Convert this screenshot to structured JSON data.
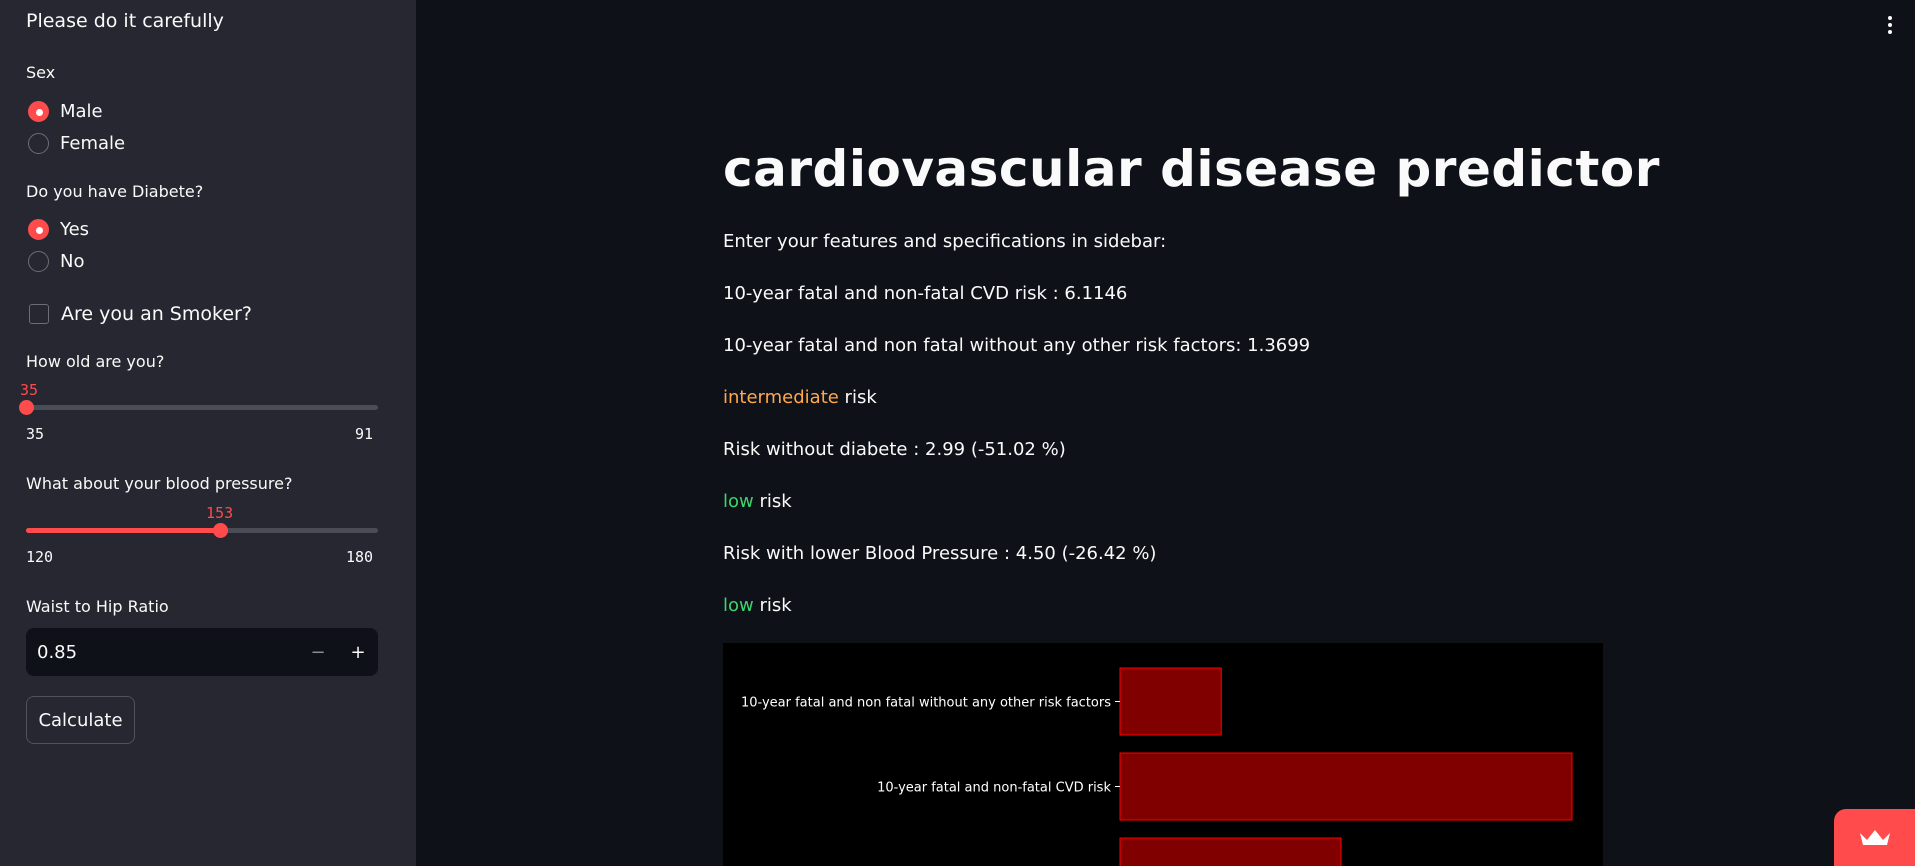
{
  "sidebar": {
    "title": "Please do it carefully",
    "sex": {
      "label": "Sex",
      "options": [
        "Male",
        "Female"
      ],
      "selected": "Male"
    },
    "diabete": {
      "label": "Do you have Diabete?",
      "options": [
        "Yes",
        "No"
      ],
      "selected": "Yes"
    },
    "smoker": {
      "label": "Are you an Smoker?",
      "checked": false
    },
    "age": {
      "label": "How old are you?",
      "value": "35",
      "min": "35",
      "max": "91"
    },
    "blood_pressure": {
      "label": "What about your blood pressure?",
      "value": "153",
      "min": "120",
      "max": "180"
    },
    "waist_hip": {
      "label": "Waist to Hip Ratio",
      "value": "0.85",
      "minus": "−",
      "plus": "+"
    },
    "calculate_label": "Calculate"
  },
  "main": {
    "title": "cardiovascular disease predictor",
    "intro": "Enter your features and specifications in sidebar:",
    "cvd_risk": "10-year fatal and non-fatal CVD risk : 6.1146",
    "cvd_risk_no_factors": "10-year fatal and non fatal without any other risk factors: 1.3699",
    "risk_level_1": {
      "word": "intermediate",
      "suffix": " risk",
      "color": "#ffa94d"
    },
    "risk_without_diabete": "Risk without diabete : 2.99 (-51.02 %)",
    "risk_level_2": {
      "word": "low",
      "suffix": " risk",
      "color": "#3dd56d"
    },
    "risk_lower_bp": "Risk with lower Blood Pressure : 4.50 (-26.42 %)",
    "risk_level_3": {
      "word": "low",
      "suffix": " risk",
      "color": "#3dd56d"
    }
  },
  "chart_data": {
    "type": "bar",
    "orientation": "horizontal",
    "categories": [
      "10-year fatal and non fatal without any other risk factors",
      "10-year fatal and non-fatal CVD risk",
      ""
    ],
    "values": [
      1.3699,
      6.1146,
      2.99
    ],
    "bar_color": "#800000",
    "bar_edge_color": "#ff0000",
    "background": "#000000"
  },
  "icons": {
    "menu": "kebab-menu-icon",
    "streamlit": "crown-icon"
  }
}
